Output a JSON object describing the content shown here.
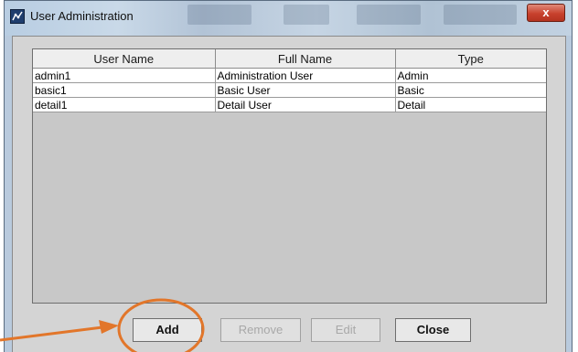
{
  "window": {
    "title": "User Administration",
    "close_glyph": "x"
  },
  "table": {
    "columns": [
      "User Name",
      "Full Name",
      "Type"
    ],
    "rows": [
      [
        "admin1",
        "Administration User",
        "Admin"
      ],
      [
        "basic1",
        "Basic User",
        "Basic"
      ],
      [
        "detail1",
        "Detail User",
        "Detail"
      ]
    ]
  },
  "buttons": {
    "add": "Add",
    "remove": "Remove",
    "edit": "Edit",
    "close": "Close"
  },
  "annotation": {
    "color": "#e2762a",
    "icon": "arrow-circle-highlight"
  }
}
